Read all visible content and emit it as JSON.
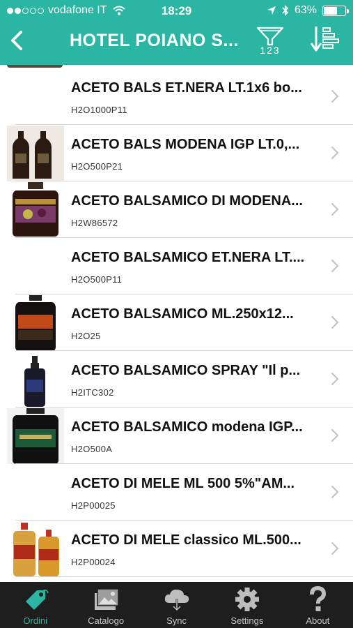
{
  "status_bar": {
    "carrier": "vodafone IT",
    "time": "18:29",
    "battery": "63%",
    "battery_level": 0.63,
    "signal_bars_filled": 2,
    "signal_bars_total": 5
  },
  "nav": {
    "title": "HOTEL POIANO S...",
    "filter_label": "123"
  },
  "products": [
    {
      "name": "ACETO BALS ET.NERA LT.1x6 bo...",
      "code": "H2O1000P11",
      "image": "none"
    },
    {
      "name": "ACETO BALS MODENA IGP LT.0,...",
      "code": "H2O500P21",
      "image": "two-dark-bottles"
    },
    {
      "name": "ACETO BALSAMICO DI MODENA...",
      "code": "H2W86572",
      "image": "dark-bottle-fruit-label"
    },
    {
      "name": "ACETO BALSAMICO ET.NERA LT....",
      "code": "H2O500P11",
      "image": "none"
    },
    {
      "name": "ACETO BALSAMICO ML.250x12...",
      "code": "H2O25",
      "image": "dark-bottle-red-label"
    },
    {
      "name": "ACETO BALSAMICO SPRAY \"Il p...",
      "code": "H2ITC302",
      "image": "spray-bottle"
    },
    {
      "name": "ACETO BALSAMICO modena IGP...",
      "code": "H2O500A",
      "image": "dark-bottle-green-label"
    },
    {
      "name": "ACETO DI MELE ML 500  5%\"AM...",
      "code": "H2P00025",
      "image": "none"
    },
    {
      "name": "ACETO DI MELE classico ML.500...",
      "code": "H2P00024",
      "image": "two-amber-bottles"
    }
  ],
  "tabs": [
    {
      "label": "Ordini",
      "icon": "tag-icon",
      "active": true
    },
    {
      "label": "Catalogo",
      "icon": "catalog-icon",
      "active": false
    },
    {
      "label": "Sync",
      "icon": "cloud-sync-icon",
      "active": false
    },
    {
      "label": "Settings",
      "icon": "gear-icon",
      "active": false
    },
    {
      "label": "About",
      "icon": "question-icon",
      "active": false
    }
  ],
  "colors": {
    "accent": "#2bb5a3",
    "tabbar_bg": "#1e1e1e",
    "tab_inactive": "#c8c8c8"
  }
}
